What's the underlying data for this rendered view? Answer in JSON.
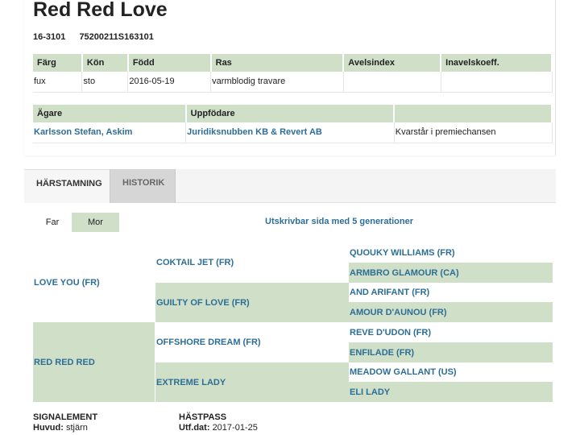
{
  "horse": {
    "name": "Red Red Love",
    "reg_no": "16-3101",
    "ueln": "75200211S163101"
  },
  "info_table": {
    "headers": [
      "Färg",
      "Kön",
      "Född",
      "Ras",
      "Avelsindex",
      "Inavelskoeff."
    ],
    "values": [
      "fux",
      "sto",
      "2016-05-19",
      "varmblodig travare",
      "",
      ""
    ]
  },
  "owner_table": {
    "headers": [
      "Ägare",
      "Uppfödare",
      ""
    ],
    "owner": "Karlsson Stefan, Askim",
    "breeder": "Juridiksnubben KB & Revert AB",
    "note": "Kvarstår i premiechansen"
  },
  "tabs": [
    {
      "label": "HÄRSTAMNING",
      "active": true
    },
    {
      "label": "HISTORIK",
      "active": false
    }
  ],
  "toggle": {
    "far": "Far",
    "mor": "Mor"
  },
  "print_link": "Utskrivbar sida med 5 generationer",
  "pedigree": {
    "gen1": [
      "LOVE YOU (FR)",
      "RED RED RED"
    ],
    "gen2": [
      "COKTAIL JET (FR)",
      "GUILTY OF LOVE (FR)",
      "OFFSHORE DREAM (FR)",
      "EXTREME LADY"
    ],
    "gen3": [
      "QUOUKY WILLIAMS (FR)",
      "ARMBRO GLAMOUR (CA)",
      "AND ARIFANT (FR)",
      "AMOUR D'AUNOU (FR)",
      "REVE D'UDON (FR)",
      "ENFILADE (FR)",
      "MEADOW GALLANT (US)",
      "ELI LADY"
    ]
  },
  "footer": {
    "signalement_label": "SIGNALEMENT",
    "huvud_label": "Huvud:",
    "huvud_value": "stjärn",
    "hastpass_label": "HÄSTPASS",
    "utfdat_label": "Utf.dat:",
    "utfdat_value": "2017-01-25"
  }
}
